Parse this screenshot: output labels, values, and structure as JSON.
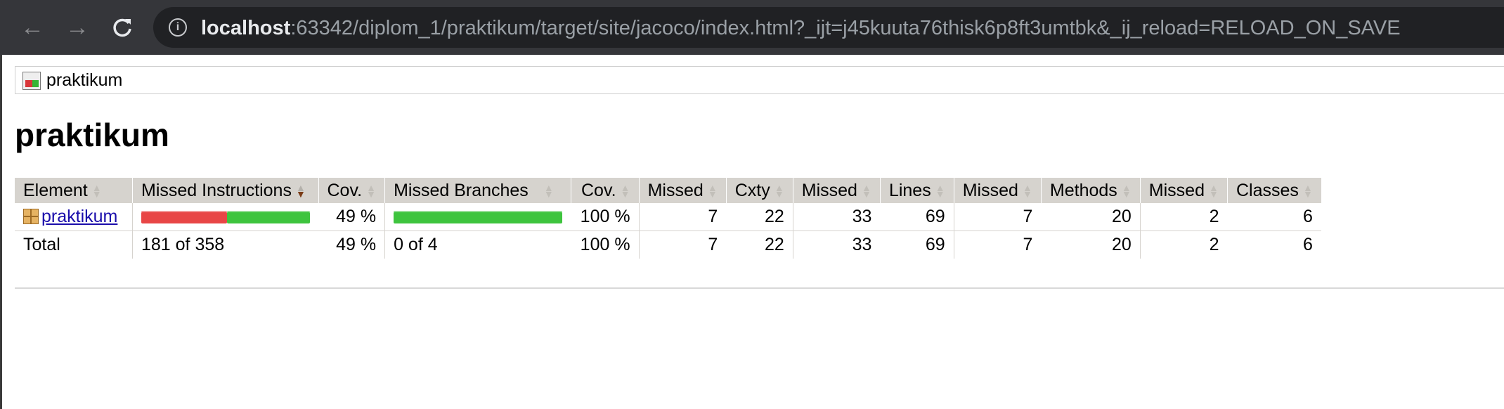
{
  "browser": {
    "url_host": "localhost",
    "url_rest": ":63342/diplom_1/praktikum/target/site/jacoco/index.html?_ijt=j45kuuta76thisk6p8ft3umtbk&_ij_reload=RELOAD_ON_SAVE"
  },
  "breadcrumb": {
    "label": "praktikum",
    "icon": "report-icon"
  },
  "page_title": "praktikum",
  "table": {
    "headers": [
      "Element",
      "Missed Instructions",
      "Cov.",
      "Missed Branches",
      "Cov.",
      "Missed",
      "Cxty",
      "Missed",
      "Lines",
      "Missed",
      "Methods",
      "Missed",
      "Classes"
    ],
    "sorted_column": "Missed Instructions",
    "rows": [
      {
        "element": "praktikum",
        "icon": "package-icon",
        "instructions_covered_fraction": 0.49,
        "instructions_cov": "49 %",
        "branches_covered_fraction": 1.0,
        "branches_cov": "100 %",
        "missed_cxty": "7",
        "cxty": "22",
        "missed_lines": "33",
        "lines": "69",
        "missed_methods": "7",
        "methods": "20",
        "missed_classes": "2",
        "classes": "6"
      }
    ],
    "total": {
      "label": "Total",
      "instructions": "181 of 358",
      "instructions_cov": "49 %",
      "branches": "0 of 4",
      "branches_cov": "100 %",
      "missed_cxty": "7",
      "cxty": "22",
      "missed_lines": "33",
      "lines": "69",
      "missed_methods": "7",
      "methods": "20",
      "missed_classes": "2",
      "classes": "6"
    }
  },
  "colors": {
    "missed": "#e84646",
    "covered": "#3ec43e",
    "header_bg": "#d6d3ce"
  }
}
